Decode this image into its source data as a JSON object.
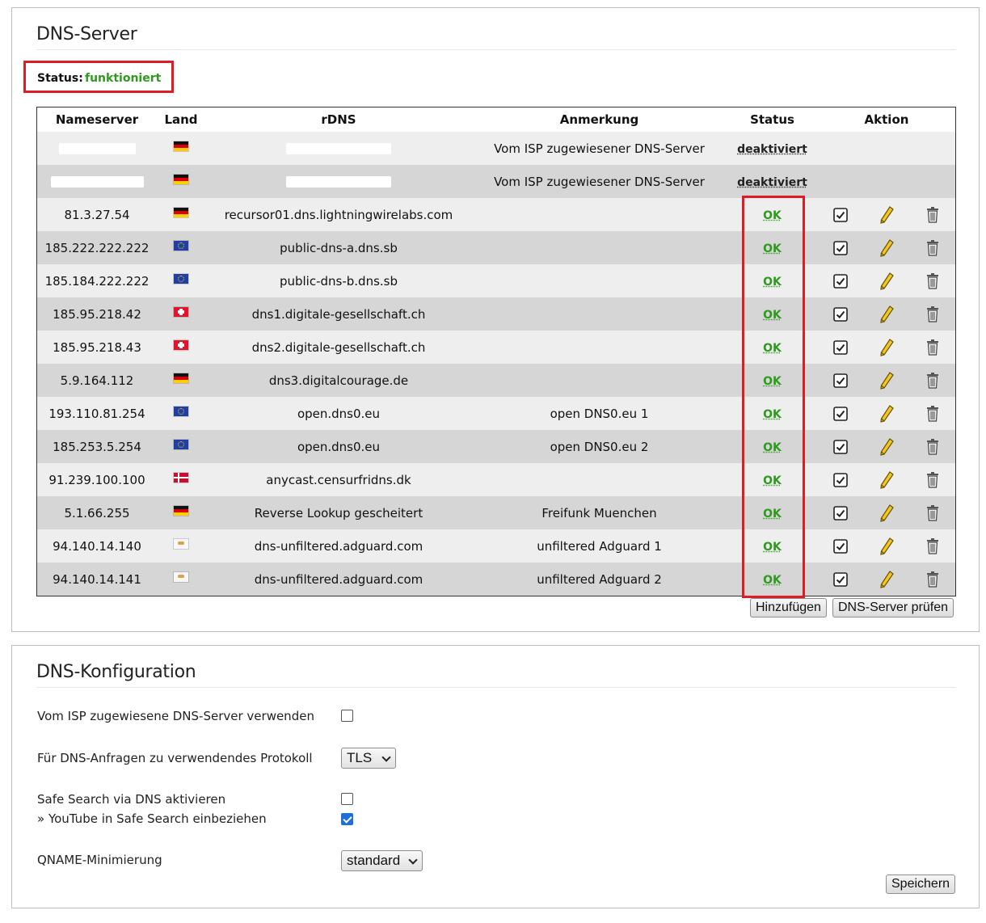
{
  "dns_server": {
    "title": "DNS-Server",
    "status_label": "Status:",
    "status_value": "funktioniert",
    "columns": [
      "Nameserver",
      "Land",
      "rDNS",
      "Anmerkung",
      "Status",
      "Aktion"
    ],
    "rows": [
      {
        "nameserver": "",
        "flag": "de",
        "rdns": "",
        "note": "Vom ISP zugewiesener DNS-Server",
        "status": "deaktiviert",
        "redacted": true,
        "actions": false
      },
      {
        "nameserver": "",
        "flag": "de",
        "rdns": "",
        "note": "Vom ISP zugewiesener DNS-Server",
        "status": "deaktiviert",
        "redacted": true,
        "actions": false
      },
      {
        "nameserver": "81.3.27.54",
        "flag": "de",
        "rdns": "recursor01.dns.lightningwirelabs.com",
        "note": "",
        "status": "OK",
        "actions": true
      },
      {
        "nameserver": "185.222.222.222",
        "flag": "eu",
        "rdns": "public-dns-a.dns.sb",
        "note": "",
        "status": "OK",
        "actions": true
      },
      {
        "nameserver": "185.184.222.222",
        "flag": "eu",
        "rdns": "public-dns-b.dns.sb",
        "note": "",
        "status": "OK",
        "actions": true
      },
      {
        "nameserver": "185.95.218.42",
        "flag": "ch",
        "rdns": "dns1.digitale-gesellschaft.ch",
        "note": "",
        "status": "OK",
        "actions": true
      },
      {
        "nameserver": "185.95.218.43",
        "flag": "ch",
        "rdns": "dns2.digitale-gesellschaft.ch",
        "note": "",
        "status": "OK",
        "actions": true
      },
      {
        "nameserver": "5.9.164.112",
        "flag": "de",
        "rdns": "dns3.digitalcourage.de",
        "note": "",
        "status": "OK",
        "actions": true
      },
      {
        "nameserver": "193.110.81.254",
        "flag": "eu",
        "rdns": "open.dns0.eu",
        "note": "open DNS0.eu 1",
        "status": "OK",
        "actions": true
      },
      {
        "nameserver": "185.253.5.254",
        "flag": "eu",
        "rdns": "open.dns0.eu",
        "note": "open DNS0.eu 2",
        "status": "OK",
        "actions": true
      },
      {
        "nameserver": "91.239.100.100",
        "flag": "dk",
        "rdns": "anycast.censurfridns.dk",
        "note": "",
        "status": "OK",
        "actions": true
      },
      {
        "nameserver": "5.1.66.255",
        "flag": "de",
        "rdns": "Reverse Lookup gescheitert",
        "note": "Freifunk Muenchen",
        "status": "OK",
        "actions": true
      },
      {
        "nameserver": "94.140.14.140",
        "flag": "cy",
        "rdns": "dns-unfiltered.adguard.com",
        "note": "unfiltered Adguard 1",
        "status": "OK",
        "actions": true
      },
      {
        "nameserver": "94.140.14.141",
        "flag": "cy",
        "rdns": "dns-unfiltered.adguard.com",
        "note": "unfiltered Adguard 2",
        "status": "OK",
        "actions": true
      }
    ],
    "add_button": "Hinzufügen",
    "check_button": "DNS-Server prüfen"
  },
  "dns_config": {
    "title": "DNS-Konfiguration",
    "isp_label": "Vom ISP zugewiesene DNS-Server verwenden",
    "isp_checked": false,
    "protocol_label": "Für DNS-Anfragen zu verwendendes Protokoll",
    "protocol_value": "TLS",
    "safesearch_label": "Safe Search via DNS aktivieren",
    "safesearch_checked": false,
    "youtube_label": "» YouTube in Safe Search einbeziehen",
    "youtube_checked": true,
    "qname_label": "QNAME-Minimierung",
    "qname_value": "standard",
    "save_button": "Speichern"
  },
  "colors": {
    "ok_green": "#2e9a1e",
    "highlight_red": "#e01b24",
    "checkbox_blue": "#1e6fd9"
  },
  "icons": {
    "enable": "checkbox-icon",
    "edit": "pencil-icon",
    "delete": "trash-icon"
  }
}
